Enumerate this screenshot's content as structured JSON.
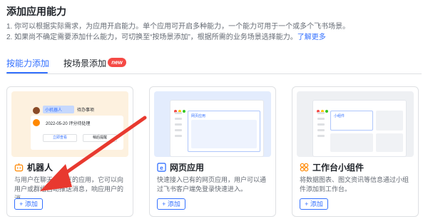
{
  "page": {
    "title": "添加应用能力",
    "desc1": "1. 你可以根据实际需求，为应用开启能力。单个应用可开启多种能力，一个能力可用于一个或多个飞书场景。",
    "desc2": "2. 如果尚不确定需要添加什么能力，可切换至“按场景添加”，根据所需的业务场景选择能力。",
    "learn_more": "了解更多"
  },
  "tabs": [
    {
      "label": "按能力添加",
      "active": true
    },
    {
      "label": "按场景添加",
      "badge": "new"
    }
  ],
  "cards": [
    {
      "name": "机器人",
      "icon": "bot-icon",
      "desc": "与用户在聊天中交互的应用，它可以向用户或群组自动推送消息，响应用户的消…",
      "add_label": "+ 添加",
      "preview": {
        "tag": "小机器人",
        "tag2": "待办事项",
        "time": "2022-05-20  评分待处理",
        "btn1": "立即查看",
        "btn2": "稍后提醒"
      }
    },
    {
      "name": "网页应用",
      "icon": "web-app-icon",
      "desc": "快速接入已有的网页应用，用户可以通过飞书客户端免登录快速进入。",
      "add_label": "+ 添加",
      "preview": {
        "tag": "网页应用"
      }
    },
    {
      "name": "工作台小组件",
      "icon": "widget-icon",
      "desc": "将数据图表、图文资讯等信息通过小组件添加到工作台。",
      "add_label": "+ 添加",
      "preview": {
        "tag": "小组件"
      }
    }
  ],
  "colors": {
    "accent": "#3370ff",
    "badge": "#f54a45",
    "arrow": "#e8392f"
  }
}
